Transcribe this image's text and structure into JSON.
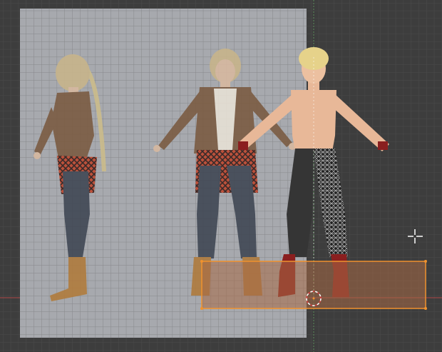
{
  "viewport": {
    "background_color": "#3d3d3d",
    "grid_color": "#4a4a4a",
    "x_axis_color": "#b04848",
    "y_axis_color": "#5a8a5a"
  },
  "reference_image": {
    "color": "#a7a9ae",
    "figures": [
      "side-view",
      "front-view"
    ]
  },
  "model": {
    "skin_color": "#e8b898",
    "hair_color": "#e6d28a",
    "pants_color": "#353535",
    "boots_color": "#8a1f1f"
  },
  "selection": {
    "border_color": "#f0922e",
    "fill_color": "#a86a46"
  },
  "cursor": {
    "icon": "move-crosshair-icon"
  },
  "origin": {
    "icon": "3d-cursor-icon"
  }
}
